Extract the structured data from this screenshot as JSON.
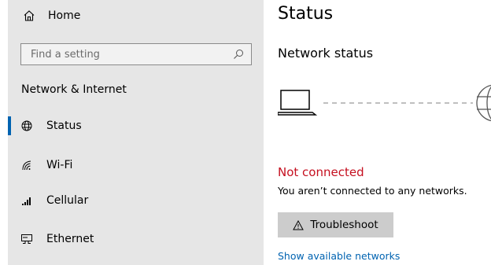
{
  "sidebar": {
    "home_label": "Home",
    "search_placeholder": "Find a setting",
    "section_title": "Network & Internet",
    "items": [
      {
        "label": "Status",
        "icon": "globe-icon",
        "selected": true
      },
      {
        "label": "Wi-Fi",
        "icon": "wifi-icon",
        "selected": false
      },
      {
        "label": "Cellular",
        "icon": "cellular-icon",
        "selected": false
      },
      {
        "label": "Ethernet",
        "icon": "ethernet-icon",
        "selected": false
      }
    ]
  },
  "main": {
    "title": "Status",
    "subtitle": "Network status",
    "connection_status": "Not connected",
    "connection_description": "You aren’t connected to any networks.",
    "troubleshoot_label": "Troubleshoot",
    "link_label": "Show available networks"
  },
  "colors": {
    "accent": "#0063b1",
    "error": "#c50f1f",
    "sidebar_bg": "#e6e6e6",
    "button_bg": "#cccccc"
  }
}
